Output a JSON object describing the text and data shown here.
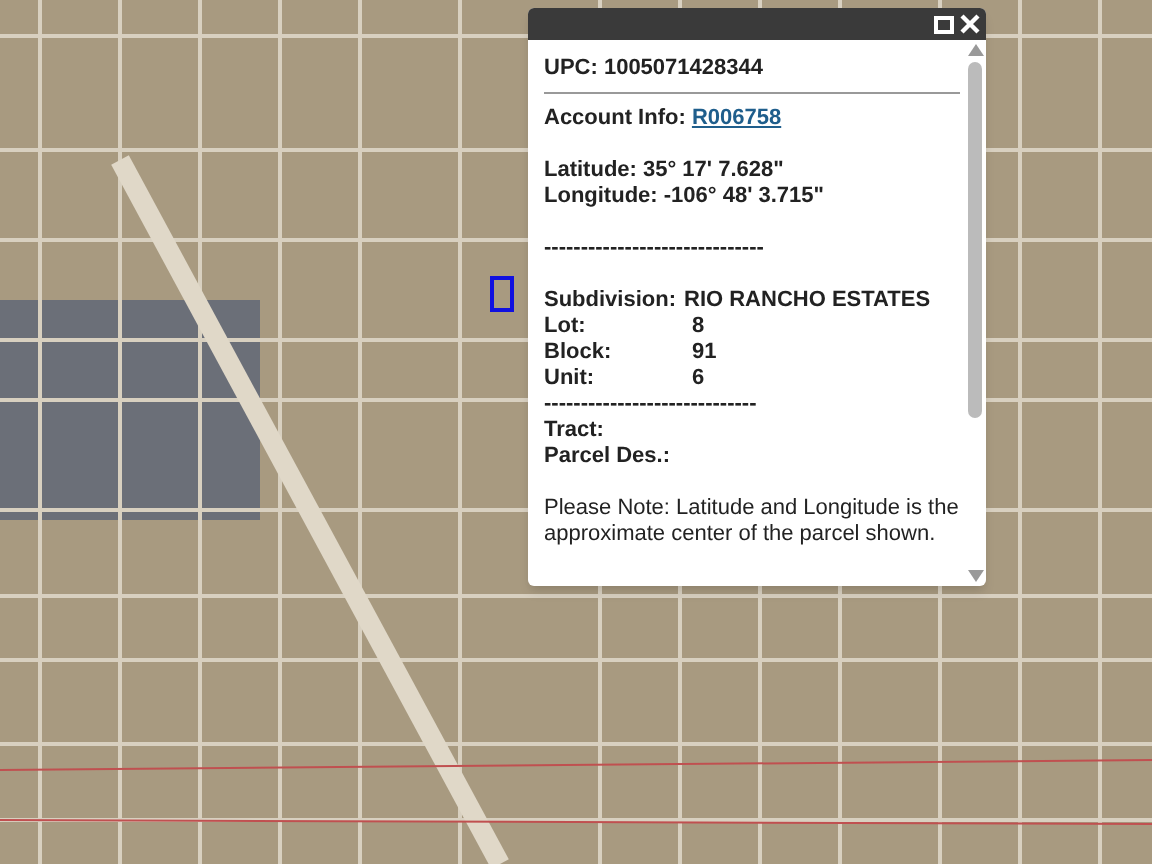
{
  "popup": {
    "upc": {
      "label": "UPC:",
      "value": "1005071428344"
    },
    "account": {
      "label": "Account Info:",
      "link": "R006758"
    },
    "coordinates": [
      "Latitude: 35° 17' 7.628\"",
      "Longitude: -106° 48' 3.715\""
    ],
    "separators": [
      "------------------------------",
      "-----------------------------"
    ],
    "details": [
      {
        "label": "Subdivision:",
        "value": "RIO RANCHO ESTATES"
      },
      {
        "label": "Lot:",
        "value": "8"
      },
      {
        "label": "Block:",
        "value": "91"
      },
      {
        "label": "Unit:",
        "value": "6"
      }
    ],
    "extra": [
      {
        "label": "Tract:"
      },
      {
        "label": "Parcel Des.:"
      }
    ],
    "note": "Please Note: Latitude and Longitude is the approximate center of the parcel shown."
  }
}
